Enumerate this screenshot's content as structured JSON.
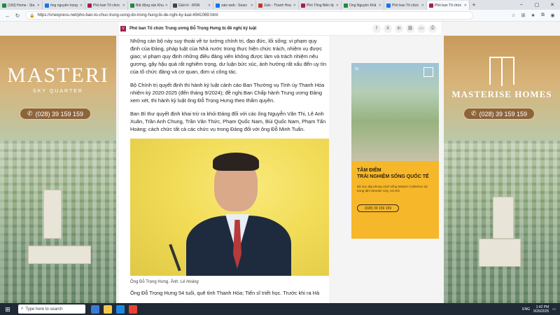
{
  "browser": {
    "tabs": [
      {
        "label": "(169) Home - Sta",
        "color": "#1f8a3d"
      },
      {
        "label": "ông nguyễn trọng",
        "color": "#1a73e8"
      },
      {
        "label": "Phó ban Tổ chức",
        "color": "#9f224e"
      },
      {
        "label": "Bất động sản Khu",
        "color": "#1f8a3d"
      },
      {
        "label": "Giải trí - MSN",
        "color": "#444444"
      },
      {
        "label": "zalo web - Searc",
        "color": "#1a73e8"
      },
      {
        "label": "Zalo - Thanh Hoa",
        "color": "#c0392b"
      },
      {
        "label": "Phó Tổng Biên tậ",
        "color": "#9f224e"
      },
      {
        "label": "Ông Nguyễn Khắ",
        "color": "#1f8a3d"
      },
      {
        "label": "Phó ban Tổ chức",
        "color": "#1a73e8"
      },
      {
        "label": "Phó ban Tổ chức",
        "color": "#9f224e",
        "active": true
      }
    ],
    "url": "https://vnexpress.net/pho-ban-to-chuc-trung-uong-do-trong-hung-bi-de-nghi-ky-luat-4941069.html"
  },
  "article": {
    "sticky_title": "Phó ban Tổ chức Trung ương Đỗ Trọng Hưng bị đề nghị kỷ luật",
    "paragraphs": [
      "Những cán bộ này suy thoái về tư tưởng chính trị, đạo đức, lối sống; vi phạm quy định của Đảng, pháp luật của Nhà nước trong thực hiện chức trách, nhiệm vụ được giao; vi phạm quy định những điều đảng viên không được làm và trách nhiệm nêu gương, gây hậu quả rất nghiêm trọng, dư luận bức xúc, ảnh hưởng rất xấu đến uy tín của tổ chức đảng và cơ quan, đơn vị công tác.",
      "Bộ Chính trị quyết định thi hành kỷ luật cảnh cáo Ban Thường vụ Tỉnh ủy Thanh Hóa nhiệm kỳ 2020-2025 (đến tháng 9/2024); đề nghị Ban Chấp hành Trung ương Đảng xem xét, thi hành kỷ luật ông Đỗ Trọng Hưng theo thẩm quyền.",
      "Ban Bí thư quyết định khai trừ ra khỏi Đảng đối với các ông Nguyễn Văn Thi, Lê Anh Xuân, Trần Anh Chung, Trần Văn Thức, Phạm Quốc Nam, Bùi Quốc Nam, Phạm Tấn Hoàng; cách chức tất cả các chức vụ trong Đảng đối với ông Đỗ Minh Tuấn."
    ],
    "caption": "Ông Đỗ Trọng Hưng. Ảnh: ",
    "caption_author": "Lê Hoàng",
    "next_paragraph": "Ông Đỗ Trọng Hưng 54 tuổi, quê tỉnh Thanh Hóa; Tiến sĩ triết học. Trước khi ra Hà"
  },
  "ads": {
    "left": {
      "brand": "MASTERI",
      "sub": "SKY QUARTER",
      "phone": "(028) 39 159 159"
    },
    "right": {
      "brand": "MASTERISE HOMES",
      "phone": "(028) 39 159 159"
    },
    "middle": {
      "headline1": "TÂM ĐIỂM",
      "headline2": "TRẢI NGHIỆM SỐNG QUỐC TẾ",
      "body": "Bộ sưu tập phong cách sống Masteri Collection tại trung tâm Wonder City, Hà Nội",
      "phone": "(028) 39 159 159"
    }
  },
  "taskbar": {
    "search_placeholder": "Type here to search",
    "lang": "ENG",
    "time": "1:42 PM",
    "date": "9/26/2025"
  }
}
